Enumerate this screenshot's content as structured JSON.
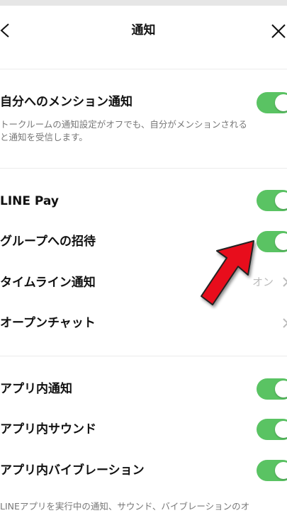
{
  "header": {
    "title": "通知"
  },
  "sections": {
    "mention": {
      "label": "自分へのメンション通知",
      "description_line1": "トークルームの通知設定がオフでも、自分がメンションされる",
      "description_line2": "と通知を受信します。",
      "toggle_on": true
    },
    "line_pay": {
      "label": "LINE Pay",
      "toggle_on": true
    },
    "group_invite": {
      "label": "グループへの招待",
      "toggle_on": true
    },
    "timeline": {
      "label": "タイムライン通知",
      "value": "オン"
    },
    "open_chat": {
      "label": "オープンチャット"
    },
    "in_app_notification": {
      "label": "アプリ内通知",
      "toggle_on": true
    },
    "in_app_sound": {
      "label": "アプリ内サウンド",
      "toggle_on": true
    },
    "in_app_vibration": {
      "label": "アプリ内バイブレーション",
      "toggle_on": true
    },
    "footer": {
      "text": "LINEアプリを実行中の通知、サウンド、バイブレーションのオ"
    }
  },
  "colors": {
    "toggle_on": "#5ac363",
    "arrow": "#e8101a"
  },
  "icons": {
    "back": "chevron-left-icon",
    "close": "close-icon",
    "chevron": "chevron-right-icon",
    "annotation": "red-arrow-icon"
  }
}
